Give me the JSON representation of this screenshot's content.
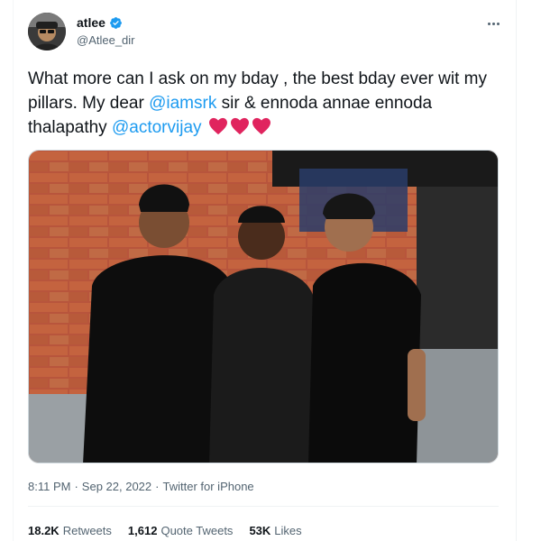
{
  "tweet": {
    "display_name": "atlee",
    "handle": "@Atlee_dir",
    "verified": true,
    "text_part1": "What more can I ask on my bday , the best bday ever wit my pillars. My dear ",
    "mention1": "@iamsrk",
    "text_part2": " sir & ennoda annae ennoda thalapathy ",
    "mention2": "@actorvijay",
    "hearts": 3,
    "time": "8:11 PM",
    "date": "Sep 22, 2022",
    "source": "Twitter for iPhone"
  },
  "stats": {
    "retweets_count": "18.2K",
    "retweets_label": "Retweets",
    "quotes_count": "1,612",
    "quotes_label": "Quote Tweets",
    "likes_count": "53K",
    "likes_label": "Likes"
  },
  "colors": {
    "accent": "#1d9bf0",
    "heart": "#e0245e",
    "secondary_text": "#536471"
  },
  "icons": {
    "verified": "verified-badge-icon",
    "more": "more-options-icon",
    "heart": "red-heart-emoji"
  }
}
